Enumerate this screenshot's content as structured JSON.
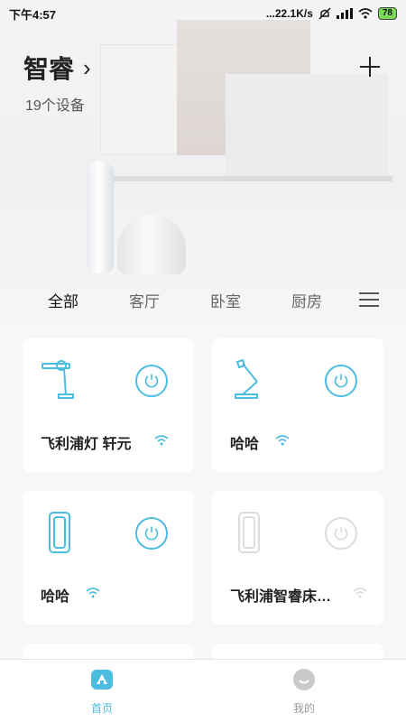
{
  "status_bar": {
    "time": "下午4:57",
    "net_speed": "...22.1K/s",
    "battery": "78"
  },
  "header": {
    "home_name": "智睿",
    "chevron": "›",
    "device_count": "19个设备",
    "add_icon": "plus-icon"
  },
  "tabs": {
    "items": [
      {
        "label": "全部",
        "active": true
      },
      {
        "label": "客厅",
        "active": false
      },
      {
        "label": "卧室",
        "active": false
      },
      {
        "label": "厨房",
        "active": false
      }
    ],
    "menu_icon": "hamburger-icon"
  },
  "devices": [
    {
      "name": "飞利浦灯 轩元",
      "icon": "desk-lamp-icon",
      "power_on": true
    },
    {
      "name": "哈哈",
      "icon": "architect-lamp-icon",
      "power_on": true
    },
    {
      "name": "哈哈",
      "icon": "bedside-lamp-icon",
      "power_on": true
    },
    {
      "name": "飞利浦智睿床…",
      "icon": "bedside-lamp-icon",
      "power_on": false
    }
  ],
  "bottom_nav": {
    "items": [
      {
        "label": "首页",
        "active": true
      },
      {
        "label": "我的",
        "active": false
      }
    ]
  },
  "colors": {
    "accent": "#4bbde0",
    "inactive": "#dcdcdc"
  }
}
